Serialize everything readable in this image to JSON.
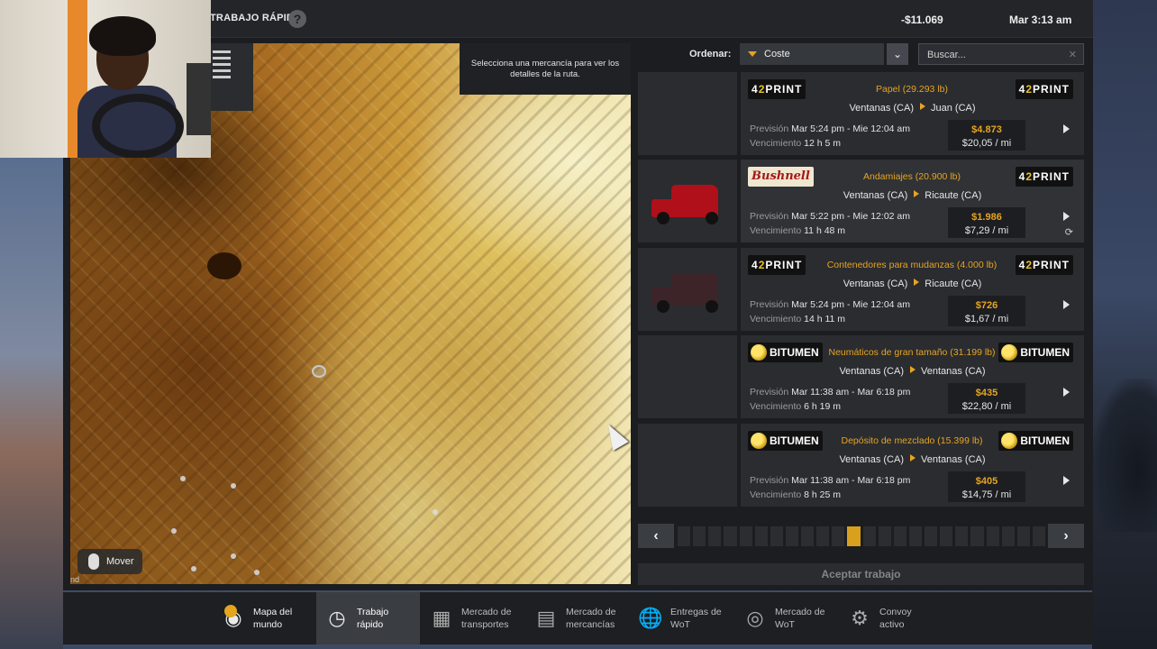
{
  "header": {
    "title": "TRABAJO RÁPIDO",
    "help_icon": "question-icon",
    "money": "-$11.069",
    "clock": "Mar 3:13 am"
  },
  "map": {
    "tooltip": "Selecciona una mercancía para ver los detalles de la ruta.",
    "move_label": "Mover",
    "corner_text": "nd"
  },
  "sort": {
    "label": "Ordenar:",
    "value": "Coste",
    "search_placeholder": "Buscar..."
  },
  "jobs": [
    {
      "cargo": "Papel (29.293 lb)",
      "from": "Ventanas (CA)",
      "to": "Juan (CA)",
      "prevision_label": "Previsión",
      "prevision": "Mar 5:24 pm - Mie 12:04 am",
      "venc_label": "Vencimiento",
      "venc": "12 h 5 m",
      "price": "$4.873",
      "rate": "$20,05 / mi",
      "logo_left": "42PRINT",
      "logo_right": "42PRINT",
      "truck": ""
    },
    {
      "cargo": "Andamiajes (20.900 lb)",
      "from": "Ventanas (CA)",
      "to": "Ricaute (CA)",
      "prevision_label": "Previsión",
      "prevision": "Mar 5:22 pm - Mie 12:02 am",
      "venc_label": "Vencimiento",
      "venc": "11 h 48 m",
      "price": "$1.986",
      "rate": "$7,29 / mi",
      "logo_left": "Bushnell",
      "logo_right": "42PRINT",
      "truck": "red"
    },
    {
      "cargo": "Contenedores para mudanzas (4.000 lb)",
      "from": "Ventanas (CA)",
      "to": "Ricaute (CA)",
      "prevision_label": "Previsión",
      "prevision": "Mar 5:24 pm - Mie 12:04 am",
      "venc_label": "Vencimiento",
      "venc": "14 h 11 m",
      "price": "$726",
      "rate": "$1,67 / mi",
      "logo_left": "42PRINT",
      "logo_right": "42PRINT",
      "truck": "maroon"
    },
    {
      "cargo": "Neumáticos de gran tamaño (31.199 lb)",
      "from": "Ventanas (CA)",
      "to": "Ventanas (CA)",
      "prevision_label": "Previsión",
      "prevision": "Mar 11:38 am - Mar 6:18 pm",
      "venc_label": "Vencimiento",
      "venc": "6 h 19 m",
      "price": "$435",
      "rate": "$22,80 / mi",
      "logo_left": "BITUMEN",
      "logo_right": "BITUMEN",
      "truck": ""
    },
    {
      "cargo": "Depósito de mezclado (15.399 lb)",
      "from": "Ventanas (CA)",
      "to": "Ventanas (CA)",
      "prevision_label": "Previsión",
      "prevision": "Mar 11:38 am - Mar 6:18 pm",
      "venc_label": "Vencimiento",
      "venc": "8 h 25 m",
      "price": "$405",
      "rate": "$14,75 / mi",
      "logo_left": "BITUMEN",
      "logo_right": "BITUMEN",
      "truck": ""
    }
  ],
  "pager": {
    "total_pages": 24,
    "current_page": 12
  },
  "accept_label": "Aceptar trabajo",
  "nav": [
    {
      "label": "Mapa del mundo",
      "icon": "world-map-icon"
    },
    {
      "label": "Trabajo rápido",
      "icon": "quick-job-icon"
    },
    {
      "label": "Mercado de transportes",
      "icon": "freight-market-icon"
    },
    {
      "label": "Mercado de mercancías",
      "icon": "cargo-market-icon"
    },
    {
      "label": "Entregas de WoT",
      "icon": "wot-globe-icon"
    },
    {
      "label": "Mercado de WoT",
      "icon": "wot-market-icon"
    },
    {
      "label": "Convoy activo",
      "icon": "convoy-icon"
    }
  ],
  "colors": {
    "accent": "#e6a422",
    "panel": "#1b1d20",
    "active_tab": "#3a3d42"
  }
}
